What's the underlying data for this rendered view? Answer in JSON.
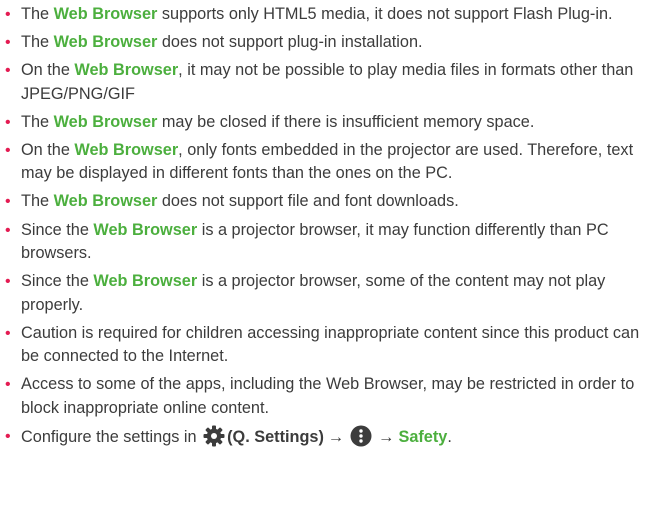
{
  "notes": [
    {
      "pre": "The ",
      "highlight": "Web Browser",
      "post": " supports only HTML5 media, it does not support Flash Plug-in."
    },
    {
      "pre": "The ",
      "highlight": "Web Browser",
      "post": " does not support plug-in installation."
    },
    {
      "pre": "On the ",
      "highlight": "Web Browser",
      "post": ", it may not be possible to play media files in formats other than JPEG/PNG/GIF"
    },
    {
      "pre": "The ",
      "highlight": "Web Browser",
      "post": " may be closed if there is insufficient memory space."
    },
    {
      "pre": "On the ",
      "highlight": "Web Browser",
      "post": ", only fonts embedded in the projector are used. Therefore, text may be displayed in different fonts than the ones on the PC."
    },
    {
      "pre": "The ",
      "highlight": "Web Browser",
      "post": " does not support file and font downloads."
    },
    {
      "pre": "Since the ",
      "highlight": "Web Browser",
      "post": " is a projector browser, it may function differently than PC browsers."
    },
    {
      "pre": "Since the ",
      "highlight": "Web Browser",
      "post": " is a projector browser, some of the content may not play properly."
    },
    {
      "text": "Caution is required for children accessing inappropriate content since this product can be connected to the Internet."
    },
    {
      "text": "Access to some of the apps, including the Web Browser, may be restricted in order to block inappropriate online content."
    }
  ],
  "settings_path": {
    "pre": "Configure the settings in ",
    "settings_label": "(Q. Settings)",
    "arrow1": "→",
    "arrow2": "→",
    "target": "Safety",
    "end": ".",
    "icons": [
      "gear-icon",
      "more-options-icon"
    ]
  },
  "colors": {
    "bullet": "#e41b52",
    "highlight": "#4caf3e",
    "text": "#3c3c3c"
  }
}
